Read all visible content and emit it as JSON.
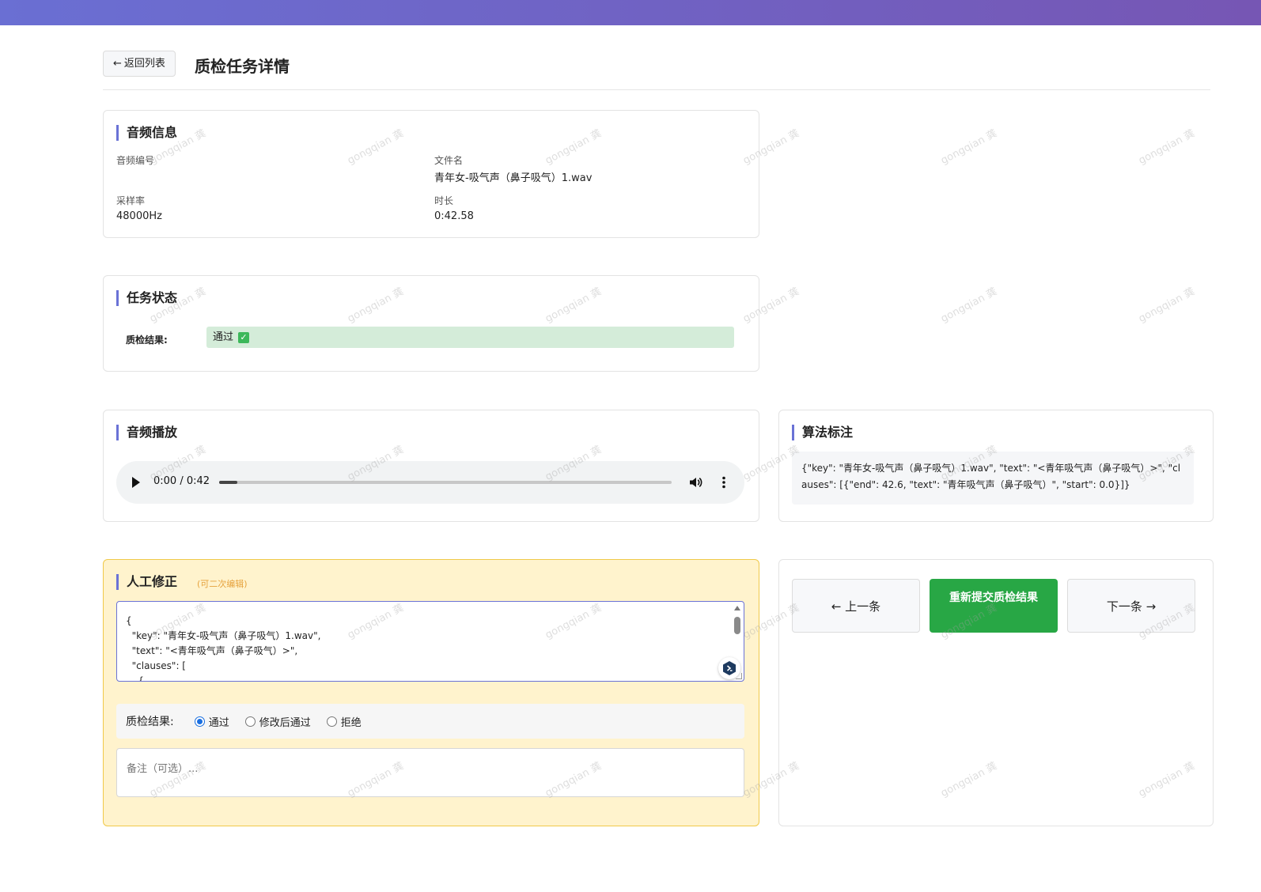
{
  "header": {
    "back_label": "返回列表",
    "title": "质检任务详情"
  },
  "audio_info": {
    "title": "音频信息",
    "id_label": "音频编号",
    "id_value": "",
    "filename_label": "文件名",
    "filename_value": "青年女-吸气声（鼻子吸气）1.wav",
    "samplerate_label": "采样率",
    "samplerate_value": "48000Hz",
    "duration_label": "时长",
    "duration_value": "0:42.58"
  },
  "task_status": {
    "title": "任务状态",
    "qc_label": "质检结果:",
    "qc_value": "通过"
  },
  "player": {
    "title": "音频播放",
    "time": "0:00 / 0:42",
    "progress": 0.04
  },
  "algo": {
    "title": "算法标注",
    "content": "{\"key\": \"青年女-吸气声（鼻子吸气）1.wav\", \"text\": \"<青年吸气声（鼻子吸气）>\", \"clauses\": [{\"end\": 42.6, \"text\": \"青年吸气声（鼻子吸气）\", \"start\": 0.0}]}"
  },
  "manual": {
    "title": "人工修正",
    "hint": "(可二次编辑)",
    "json_lines": [
      "{",
      "  \"key\": \"青年女-吸气声（鼻子吸气）1.wav\",",
      "  \"text\": \"<青年吸气声（鼻子吸气）>\",",
      "  \"clauses\": [",
      "    {"
    ],
    "qc_label": "质检结果:",
    "options": [
      "通过",
      "修改后通过",
      "拒绝"
    ],
    "selected": "通过",
    "remark_placeholder": "备注（可选）..."
  },
  "actions": {
    "prev_label": "← 上一条",
    "submit_label": "重新提交质检结果",
    "next_label": "下一条 →"
  },
  "watermark": "gongqian 龚",
  "colors": {
    "accent": "#6a72d6",
    "success": "#28a745",
    "pass_bg": "#d4ecd9",
    "edit_bg": "#fff3cd"
  }
}
